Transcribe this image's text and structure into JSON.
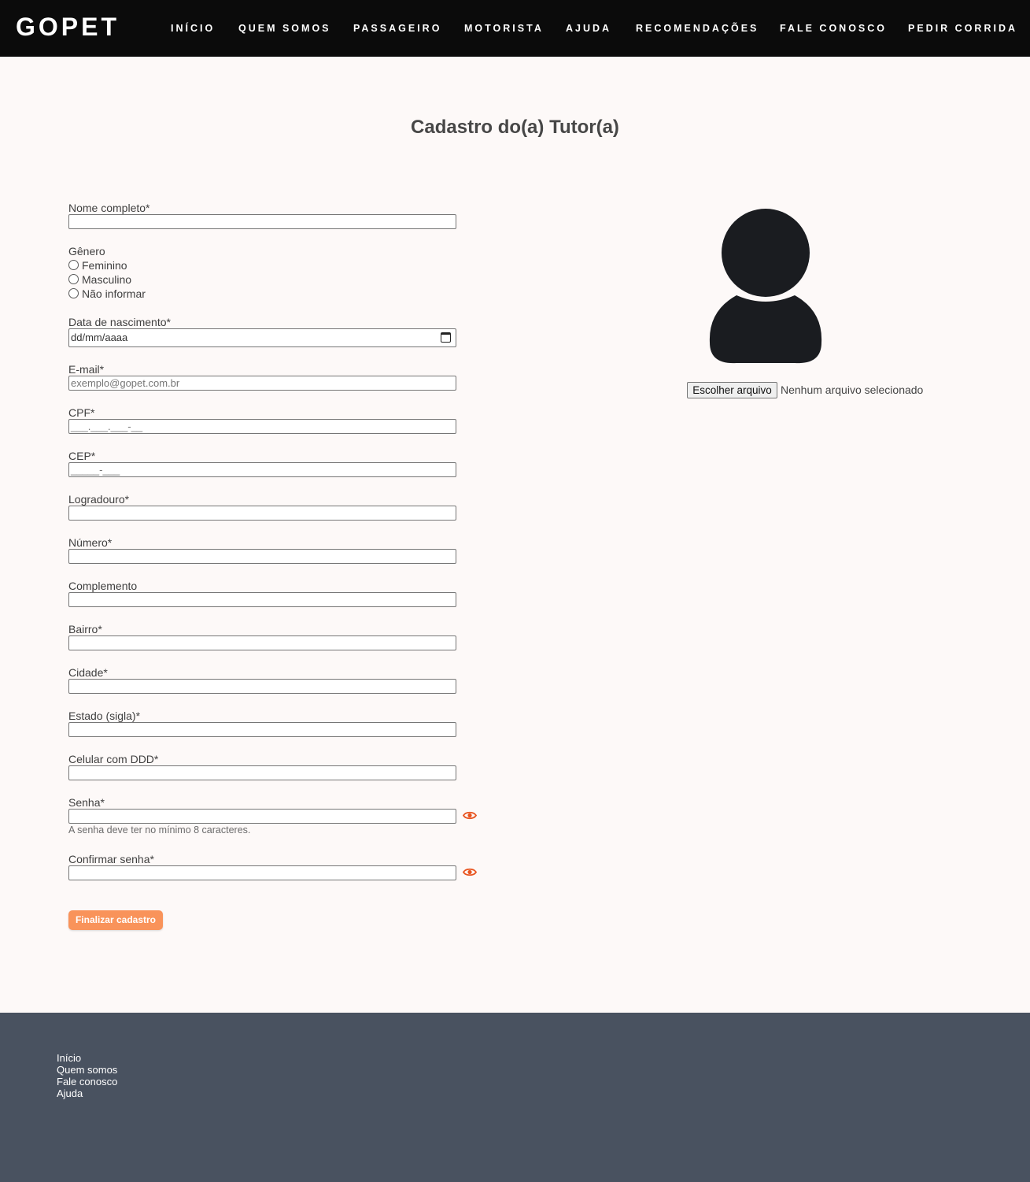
{
  "nav": {
    "logo": "GOPET",
    "links": [
      "INÍCIO",
      "QUEM SOMOS",
      "PASSAGEIRO",
      "MOTORISTA",
      "AJUDA",
      "RECOMENDAÇÕES",
      "FALE CONOSCO",
      "PEDIR CORRIDA"
    ]
  },
  "page": {
    "title": "Cadastro do(a) Tutor(a)"
  },
  "form": {
    "nome_label": "Nome completo*",
    "genero_label": "Gênero",
    "genero_options": [
      "Feminino",
      "Masculino",
      "Não informar"
    ],
    "nascimento_label": "Data de nascimento*",
    "nascimento_placeholder": "dd/mm/aaaa",
    "email_label": "E-mail*",
    "email_placeholder": "exemplo@gopet.com.br",
    "cpf_label": "CPF*",
    "cpf_mask": "___.___.___-__",
    "cep_label": "CEP*",
    "cep_mask": "_____-___",
    "logradouro_label": "Logradouro*",
    "numero_label": "Número*",
    "complemento_label": "Complemento",
    "bairro_label": "Bairro*",
    "cidade_label": "Cidade*",
    "estado_label": "Estado (sigla)*",
    "celular_label": "Celular com DDD*",
    "senha_label": "Senha*",
    "senha_help": "A senha deve ter no mínimo 8 caracteres.",
    "confirmar_label": "Confirmar senha*",
    "submit_label": "Finalizar cadastro"
  },
  "upload": {
    "button_label": "Escolher arquivo",
    "status": "Nenhum arquivo selecionado",
    "avatar_icon": "user-silhouette-icon"
  },
  "footer": {
    "links": [
      "Início",
      "Quem somos",
      "Fale conosco",
      "Ajuda"
    ]
  },
  "colors": {
    "navbar": "#0b0b0b",
    "background": "#fdf9f8",
    "accent": "#f9935a",
    "eye_icon": "#e8541f",
    "footer": "#495260"
  }
}
